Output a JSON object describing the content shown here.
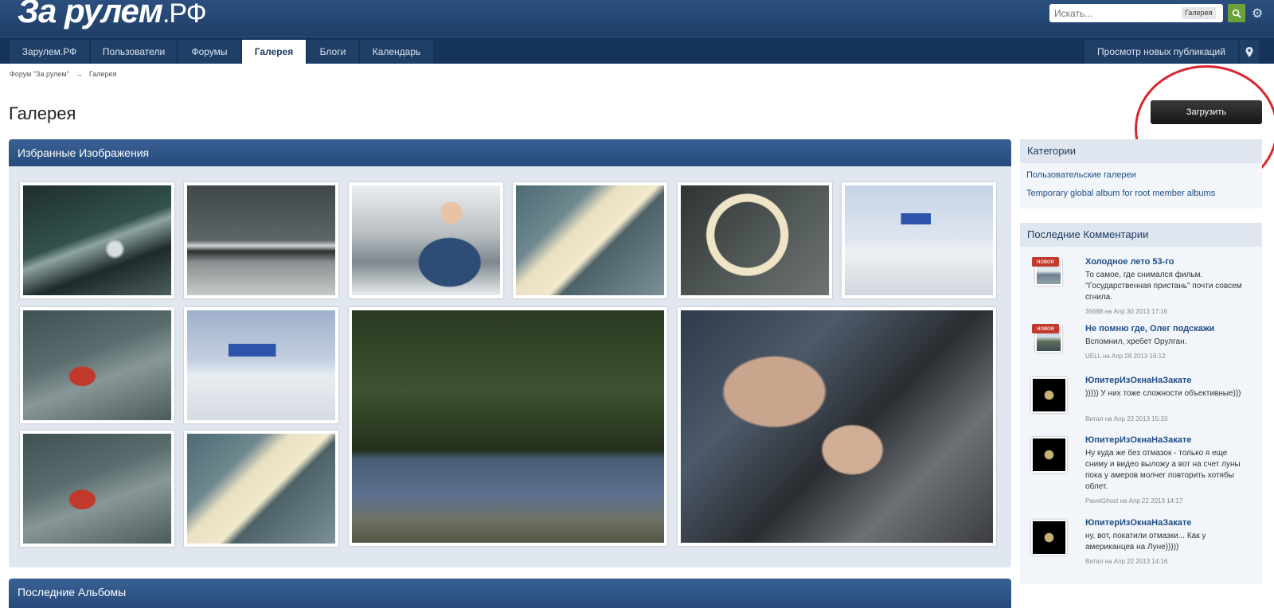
{
  "header": {
    "logo_text": "За рулем",
    "logo_suffix": ".РФ",
    "search_placeholder": "Искать...",
    "search_scope": "Галерея",
    "search_icon": "search-icon",
    "settings_icon": "gear-icon"
  },
  "nav": {
    "tabs": [
      {
        "label": "Зарулем.РФ"
      },
      {
        "label": "Пользователи"
      },
      {
        "label": "Форумы"
      },
      {
        "label": "Галерея",
        "active": true
      },
      {
        "label": "Блоги"
      },
      {
        "label": "Календарь"
      }
    ],
    "new_posts": "Просмотр новых публикаций",
    "pin_icon": "map-pin-icon"
  },
  "breadcrumb": {
    "items": [
      "Форум \"За рулем\"",
      "Галерея"
    ],
    "separator": "→"
  },
  "page": {
    "title": "Галерея",
    "upload_label": "Загрузить"
  },
  "featured": {
    "title": "Избранные Изображения"
  },
  "latest_albums": {
    "title": "Последние Альбомы"
  },
  "sidebar": {
    "categories": {
      "title": "Категории",
      "links": [
        "Пользовательские галереи",
        "Temporary global album for root member albums"
      ]
    },
    "comments": {
      "title": "Последние Комментарии",
      "badge": "новое",
      "items": [
        {
          "title": "Холодное лето 53-го",
          "text": "То самое, где снимался фильм. \"Государственная пристань\" почти совсем сгнила.",
          "meta": "35688 на Апр 30 2013 17:16",
          "is_new": true
        },
        {
          "title": "Не помню где, Олег подскажи",
          "text": "Вспомнил, хребет Орулган.",
          "meta": "UELL на Апр 28 2013 16:12",
          "is_new": true
        },
        {
          "title": "ЮпитерИзОкнаНаЗакате",
          "text": "))))) У них тоже сложности объективные)))",
          "meta": "Витал на Апр 22 2013 15:33",
          "is_new": false
        },
        {
          "title": "ЮпитерИзОкнаНаЗакате",
          "text": "Ну куда же без отмазок - только я еще сниму и видео выложу а вот на счет луны пока у амеров молчег повторить хотябы облет.",
          "meta": "PavelGhost на Апр 22 2013 14:17",
          "is_new": false
        },
        {
          "title": "ЮпитерИзОкнаНаЗакате",
          "text": "ну, вот, покатили отмазки... Как у американцев на Луне)))))",
          "meta": "Витал на Апр 22 2013 14:16",
          "is_new": false
        }
      ]
    }
  },
  "colors": {
    "header_bg": "#264a7a",
    "nav_bg": "#16345a",
    "link": "#1f4e86",
    "badge": "#c0392b",
    "search_btn": "#6ca03a",
    "annotation": "#d9262e"
  }
}
